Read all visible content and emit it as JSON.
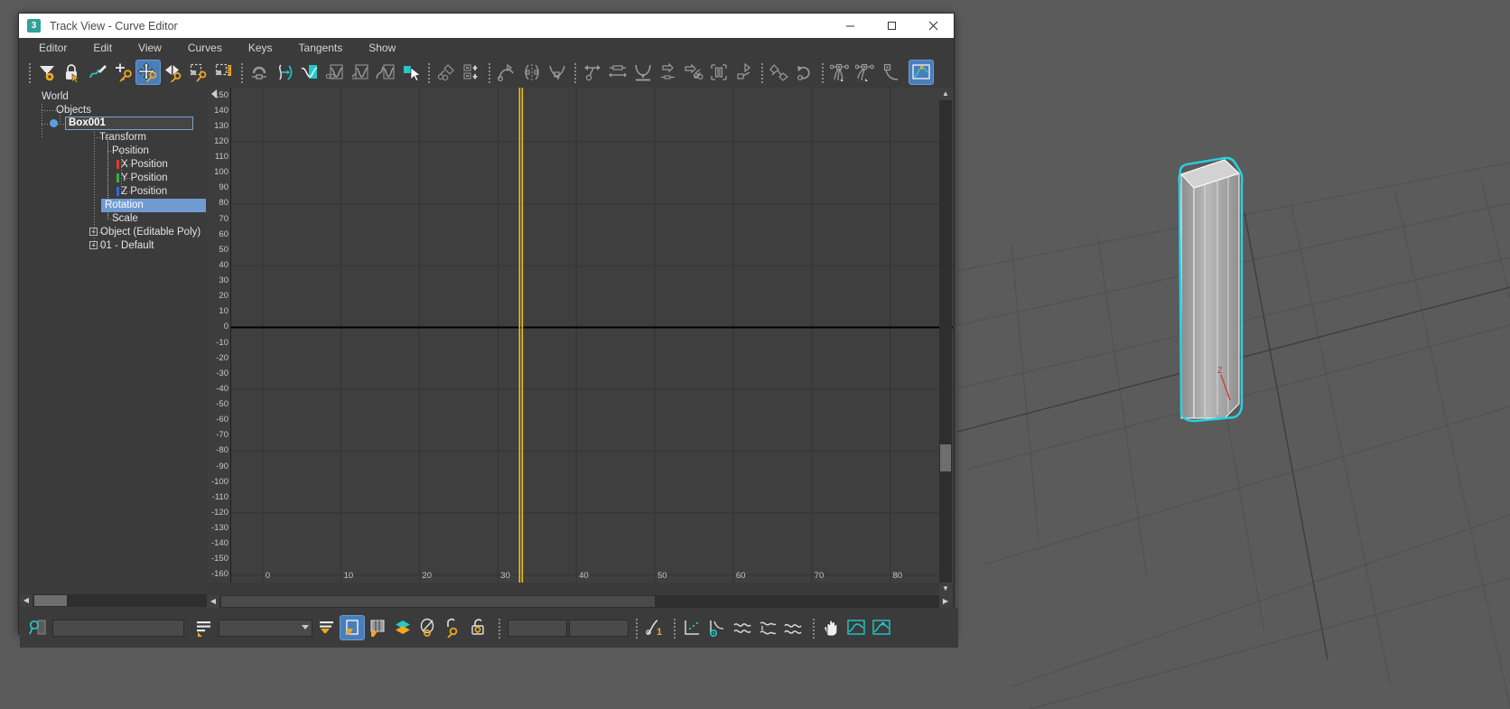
{
  "window": {
    "title": "Track View - Curve Editor",
    "app_icon": "3dsmax-icon",
    "controls": [
      {
        "name": "minimize-button",
        "glyph": "–"
      },
      {
        "name": "maximize-button",
        "glyph": "☐"
      },
      {
        "name": "close-button",
        "glyph": "✕"
      }
    ]
  },
  "menubar": {
    "items": [
      "Editor",
      "Edit",
      "View",
      "Curves",
      "Keys",
      "Tangents",
      "Show"
    ]
  },
  "toolbar": {
    "items": [
      {
        "name": "filters-button",
        "icon": "filter-gear-icon",
        "selected": false
      },
      {
        "name": "lock-selection-button",
        "icon": "lock-cursor-icon",
        "selected": false
      },
      {
        "name": "draw-curves-button",
        "icon": "pencil-curve-icon",
        "selected": false
      },
      {
        "name": "add-keys-button",
        "icon": "plus-key-icon",
        "selected": false
      },
      {
        "name": "move-keys-button",
        "icon": "move-key-icon",
        "selected": true
      },
      {
        "name": "slide-keys-button",
        "icon": "slide-key-icon",
        "selected": false
      },
      {
        "name": "scale-keys-button",
        "icon": "scale-key-icon",
        "selected": false
      },
      {
        "name": "scale-values-button",
        "icon": "scale-values-icon",
        "selected": false
      },
      {
        "name": "snap-frames-button",
        "icon": "magnet-icon",
        "selected": false
      },
      {
        "name": "parameter-curve-out-of-range-button",
        "icon": "curve-out-of-range-icon",
        "selected": false
      },
      {
        "name": "show-tangents-button",
        "icon": "tangent-teal-icon",
        "selected": false
      },
      {
        "name": "lock-tangents-button",
        "icon": "lock-tangents-icon",
        "selected": false
      },
      {
        "name": "show-biped-curves-button",
        "icon": "biped-curve-icon",
        "selected": false
      },
      {
        "name": "region-select-button",
        "icon": "region-curve-icon",
        "selected": false
      },
      {
        "name": "edit-keys-button",
        "icon": "select-arrow-icon",
        "selected": false
      },
      {
        "name": "assign-controller-button",
        "icon": "assign-controller-icon",
        "selected": false
      },
      {
        "name": "copy-paste-tracks-button",
        "icon": "copy-tracks-icon",
        "selected": false
      },
      {
        "name": "ease-curve-button",
        "icon": "ease-curve-icon",
        "selected": false
      },
      {
        "name": "mirror-keys-button",
        "icon": "mirror-keys-icon",
        "selected": false
      },
      {
        "name": "reduce-keys-button",
        "icon": "reduce-keys-icon",
        "selected": false
      },
      {
        "name": "move-horizontal-button",
        "icon": "move-horizontal-icon",
        "selected": false
      },
      {
        "name": "align-keys-button",
        "icon": "align-keys-icon",
        "selected": false
      },
      {
        "name": "flatten-curve-button",
        "icon": "flatten-curve-icon",
        "selected": false
      },
      {
        "name": "apply-ease-button",
        "icon": "apply-ease-icon",
        "selected": false
      },
      {
        "name": "freeze-tangents-button",
        "icon": "freeze-tangents-icon",
        "selected": false
      },
      {
        "name": "add-remove-keys-button",
        "icon": "add-remove-keys-icon",
        "selected": false
      },
      {
        "name": "soft-select-button",
        "icon": "soft-select-icon",
        "selected": false
      },
      {
        "name": "auto-tangent-button",
        "icon": "auto-tangent-icon",
        "selected": false
      },
      {
        "name": "loop-button",
        "icon": "loop-arrow-icon",
        "selected": false
      },
      {
        "name": "set-tangent-auto-button",
        "icon": "tangent-auto-icon",
        "selected": false
      },
      {
        "name": "set-tangent-custom-button",
        "icon": "tangent-custom-icon",
        "selected": false
      },
      {
        "name": "set-tangent-fast-button",
        "icon": "tangent-fast-icon",
        "selected": false
      },
      {
        "name": "curve-editor-mode-button",
        "icon": "curve-editor-icon",
        "selected": true
      }
    ]
  },
  "tree": {
    "nodes": [
      {
        "label": "World",
        "indent": 0,
        "state": "normal"
      },
      {
        "label": "Objects",
        "indent": 1,
        "state": "normal"
      },
      {
        "label": "Box001",
        "indent": 2,
        "state": "boxed"
      },
      {
        "label": "Transform",
        "indent": 3,
        "state": "normal"
      },
      {
        "label": "Position",
        "indent": 4,
        "state": "normal"
      },
      {
        "label": "X Position",
        "indent": 5,
        "state": "normal",
        "axis_color": "#e03a2a"
      },
      {
        "label": "Y Position",
        "indent": 5,
        "state": "normal",
        "axis_color": "#36b33c"
      },
      {
        "label": "Z Position",
        "indent": 5,
        "state": "normal",
        "axis_color": "#2a6de0"
      },
      {
        "label": "Rotation",
        "indent": 4,
        "state": "selected"
      },
      {
        "label": "Scale",
        "indent": 4,
        "state": "normal"
      },
      {
        "label": "Object (Editable Poly)",
        "indent": 3,
        "state": "normal",
        "expandable": true
      },
      {
        "label": "01 - Default",
        "indent": 3,
        "state": "normal",
        "expandable": true
      }
    ]
  },
  "chart_data": {
    "type": "line",
    "title": "",
    "xlabel": "",
    "ylabel": "",
    "xlim": [
      -4,
      88
    ],
    "ylim": [
      -165,
      155
    ],
    "ytick_step": 10,
    "yticks": [
      150,
      140,
      130,
      120,
      110,
      100,
      90,
      80,
      70,
      60,
      50,
      40,
      30,
      20,
      10,
      0,
      -10,
      -20,
      -30,
      -40,
      -50,
      -60,
      -70,
      -80,
      -90,
      -100,
      -110,
      -120,
      -130,
      -140,
      -150,
      -160
    ],
    "xticks": [
      0,
      10,
      20,
      30,
      40,
      50,
      60,
      70,
      80
    ],
    "grid": true,
    "series": [
      {
        "name": "Rotation",
        "color": "#000000",
        "x": [
          -4,
          88
        ],
        "values": [
          0,
          0
        ]
      }
    ],
    "time_marker": {
      "frame": 33,
      "color": "#e8c020",
      "label": "current-time"
    },
    "legend": "none"
  },
  "graph": {
    "collapse_icon": "collapse-left-arrow-icon"
  },
  "bottom_bar": {
    "stats_placeholder": "",
    "filter_value": "",
    "key_x_value": "",
    "key_y_value": "",
    "items": [
      {
        "name": "key-stats-field",
        "icon": "key-magnifier-icon"
      },
      {
        "name": "track-name-field",
        "icon": "text-field"
      },
      {
        "name": "key-filter-button",
        "icon": "filter-lines-icon"
      },
      {
        "name": "controller-combo",
        "icon": "dropdown"
      },
      {
        "name": "key-tangent-button",
        "icon": "filter-key-icon"
      },
      {
        "name": "key-mode-button",
        "icon": "key-mode-icon",
        "selected": true
      },
      {
        "name": "key-window-button",
        "icon": "key-window-icon"
      },
      {
        "name": "layers-button",
        "icon": "layers-diamond-icon"
      },
      {
        "name": "key-filters-button",
        "icon": "circle-key-icon"
      },
      {
        "name": "key-lock-button",
        "icon": "hook-key-icon"
      },
      {
        "name": "lock-key-button",
        "icon": "padlock-key-icon"
      },
      {
        "name": "value-x-field",
        "icon": "text-field"
      },
      {
        "name": "value-y-field",
        "icon": "text-field"
      },
      {
        "name": "tangent-info-button",
        "icon": "tangent-info-icon"
      },
      {
        "name": "zoom-region-button",
        "icon": "zoom-region-icon"
      },
      {
        "name": "zoom-value-button",
        "icon": "zoom-value-icon"
      },
      {
        "name": "zoom-horizontal-button",
        "icon": "zoom-horizontal-icon"
      },
      {
        "name": "zoom-time-button",
        "icon": "zoom-time-icon"
      },
      {
        "name": "zoom-curve-button",
        "icon": "zoom-curve-icon"
      },
      {
        "name": "pan-button",
        "icon": "hand-icon"
      },
      {
        "name": "zoom-selected-button",
        "icon": "zoom-selected-icon"
      },
      {
        "name": "zoom-region-tool-button",
        "icon": "zoom-region-tool-icon",
        "selected": false
      }
    ]
  },
  "viewport": {
    "object_name": "Box001",
    "gizmo_axis_label": "Z",
    "selection_color": "#22d3e8",
    "grid_color": "#4f4f4f"
  },
  "colors": {
    "accent_blue": "#4a7ebb",
    "window_bg": "#3b3b3b",
    "plot_bg": "#3f3f3f",
    "time_marker": "#e8c020",
    "curve": "#000000"
  }
}
